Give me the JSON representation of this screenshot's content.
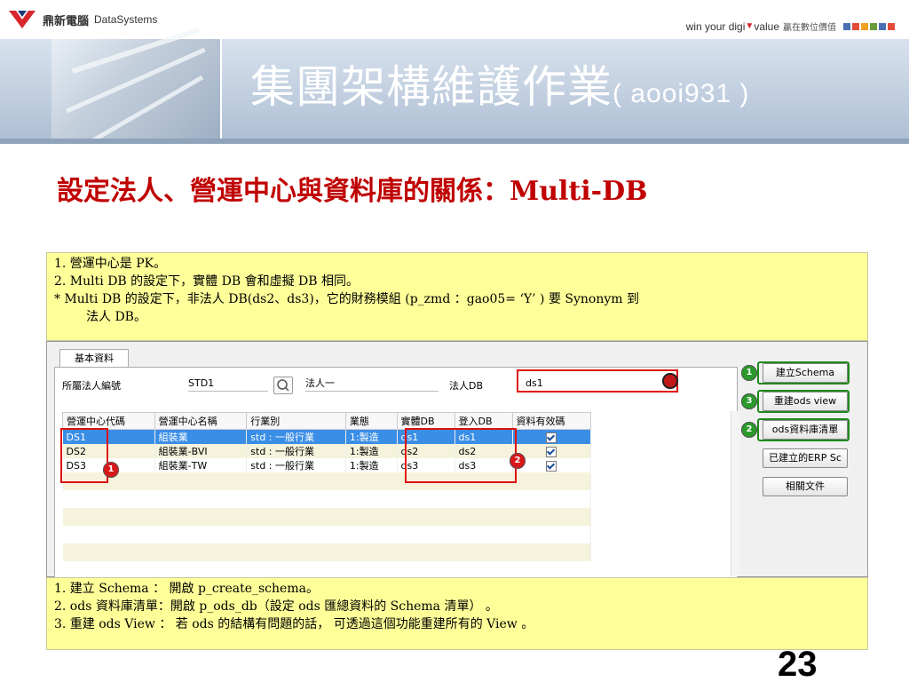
{
  "brand": {
    "name_cn": "鼎新電腦",
    "name_en": "DataSystems",
    "slogan_en_1": "win your digi",
    "slogan_en_2": "value",
    "slogan_cn": "贏在數位價值"
  },
  "colors": {
    "accent_red": "#c00000",
    "note_yellow": "#ffff99",
    "squares": [
      "#4a6fb5",
      "#e24a3a",
      "#f0a020",
      "#6a9a3a",
      "#4a6fb5",
      "#e24a3a"
    ]
  },
  "page": {
    "title": "集團架構維護作業",
    "code": "( aooi931 )",
    "subtitle": "設定法人、營運中心與資料庫的關係：Multi-DB",
    "page_number": "23"
  },
  "note_top": [
    "1.  營運中心是 PK。",
    "2.  Multi DB 的設定下，實體 DB 會和虛擬 DB 相同。",
    "* Multi DB 的設定下，非法人 DB(ds2、ds3)，它的財務模組 (p_zmd ：gao05= ‘Y’ ) 要 Synonym 到",
    "法人 DB。"
  ],
  "note_bottom": [
    "1.  建立 Schema ： 開啟 p_create_schema。",
    "2.  ods 資料庫清單：開啟 p_ods_db（設定 ods 匯總資料的 Schema 清單） 。",
    "3.  重建 ods View ： 若 ods 的結構有問題的話， 可透過這個功能重建所有的 View 。"
  ],
  "app": {
    "tab": "基本資料",
    "entity_label": "所屬法人編號",
    "entity_value": "STD1",
    "entity_name": "法人一",
    "db_label": "法人DB",
    "db_value": "ds1",
    "columns": [
      "營運中心代碼",
      "營運中心名稱",
      "行業別",
      "業態",
      "實體DB",
      "登入DB",
      "資料有效碼"
    ],
    "rows": [
      [
        "DS1",
        "組裝業",
        "std : 一般行業",
        "1:製造",
        "ds1",
        "ds1"
      ],
      [
        "DS2",
        "組裝業-BVI",
        "std : 一般行業",
        "1:製造",
        "ds2",
        "ds2"
      ],
      [
        "DS3",
        "組裝業-TW",
        "std : 一般行業",
        "1:製造",
        "ds3",
        "ds3"
      ]
    ],
    "buttons": [
      "建立Schema",
      "重建ods view",
      "ods資料庫清單",
      "已建立的ERP Sc",
      "相關文件"
    ],
    "badges": {
      "b1": "1",
      "b2": "2",
      "b3": "3"
    }
  }
}
